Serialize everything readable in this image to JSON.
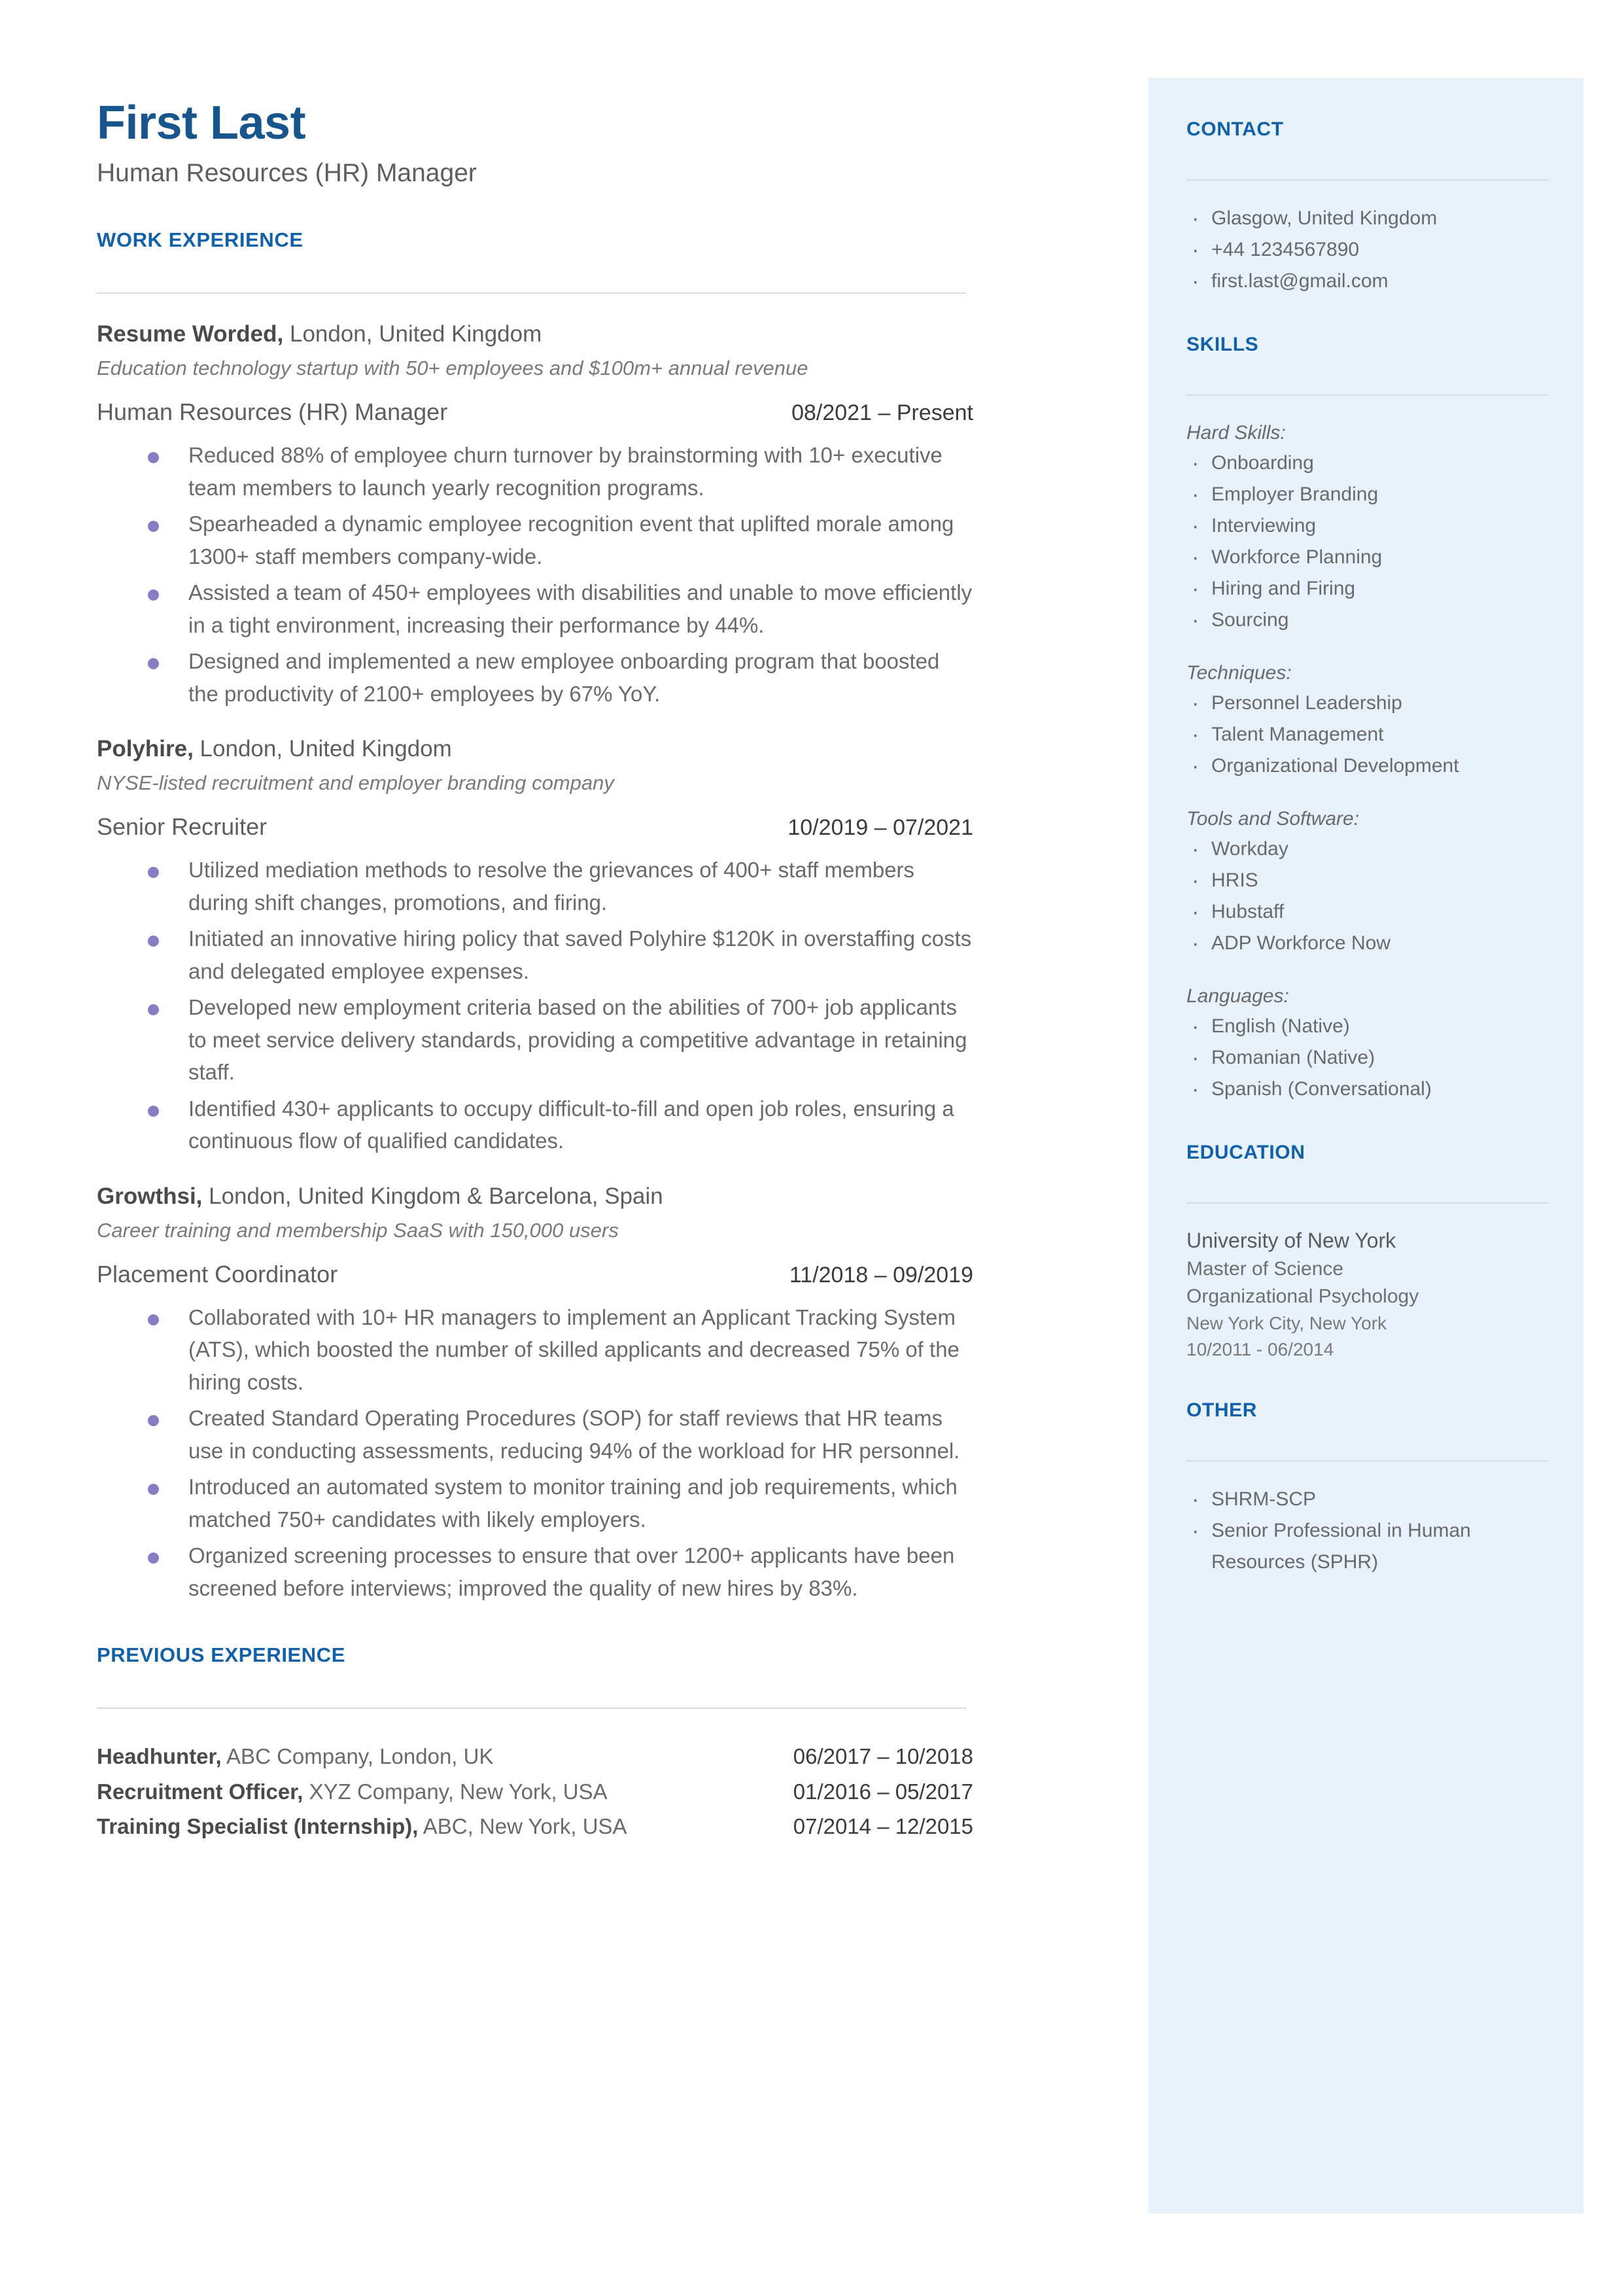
{
  "header": {
    "name": "First Last",
    "title": "Human Resources (HR) Manager"
  },
  "colors": {
    "heading_blue": "#1160aa",
    "name_blue": "#17558c",
    "sidebar_bg": "#e7f2fc",
    "bullet_purple": "#8a7cc4",
    "body_gray": "#6a6a6a",
    "rule_gray": "#dcdcdc"
  },
  "work_experience": {
    "heading": "WORK EXPERIENCE",
    "jobs": [
      {
        "company": "Resume Worded,",
        "location": " London, United Kingdom",
        "description": "Education technology startup with 50+ employees and $100m+ annual revenue",
        "role": "Human Resources (HR) Manager",
        "dates": "08/2021 – Present",
        "bullets": [
          "Reduced 88% of employee churn turnover by brainstorming with 10+ executive team members to launch yearly recognition programs.",
          "Spearheaded a dynamic employee recognition event that uplifted morale among 1300+ staff members company-wide.",
          "Assisted a team of 450+ employees with disabilities and unable to move efficiently in a tight environment, increasing their performance by 44%.",
          "Designed and implemented a new employee onboarding program that boosted the productivity of 2100+ employees by 67% YoY."
        ]
      },
      {
        "company": "Polyhire,",
        "location": " London, United Kingdom",
        "description": "NYSE-listed recruitment and employer branding company",
        "role": "Senior Recruiter",
        "dates": "10/2019 – 07/2021",
        "bullets": [
          "Utilized mediation methods to resolve the grievances of 400+ staff members during shift changes, promotions, and firing.",
          "Initiated an innovative hiring policy that saved Polyhire $120K in overstaffing costs and delegated employee expenses.",
          "Developed new employment criteria based on the abilities of 700+ job applicants to meet service delivery standards, providing a competitive advantage in retaining staff.",
          "Identified 430+ applicants to occupy difficult-to-fill and open job roles, ensuring a continuous flow of qualified candidates."
        ]
      },
      {
        "company": "Growthsi,",
        "location": " London, United Kingdom & Barcelona, Spain",
        "description": "Career training and membership SaaS with 150,000 users",
        "role": "Placement Coordinator",
        "dates": "11/2018 – 09/2019",
        "bullets": [
          "Collaborated with 10+ HR managers to implement an Applicant Tracking System (ATS), which boosted the number of skilled applicants and decreased 75% of the hiring costs.",
          "Created Standard Operating Procedures (SOP) for staff reviews that HR teams use in conducting assessments, reducing 94% of the workload for HR personnel.",
          "Introduced an automated system to monitor training and job requirements, which matched 750+ candidates with likely employers.",
          "Organized screening processes to ensure that over 1200+ applicants have been screened before interviews; improved the quality of new hires by 83%."
        ]
      }
    ]
  },
  "previous_experience": {
    "heading": "PREVIOUS EXPERIENCE",
    "rows": [
      {
        "role": "Headhunter,",
        "detail": " ABC Company, London, UK",
        "dates": "06/2017 – 10/2018"
      },
      {
        "role": "Recruitment Officer,",
        "detail": " XYZ Company, New York, USA",
        "dates": "01/2016 – 05/2017"
      },
      {
        "role": "Training Specialist (Internship),",
        "detail": " ABC, New York, USA",
        "dates": "07/2014 – 12/2015"
      }
    ]
  },
  "sidebar": {
    "contact": {
      "heading": "CONTACT",
      "items": [
        "Glasgow, United Kingdom",
        "+44 1234567890",
        "first.last@gmail.com"
      ]
    },
    "skills": {
      "heading": "SKILLS",
      "groups": [
        {
          "label": "Hard Skills:",
          "items": [
            "Onboarding",
            "Employer Branding",
            "Interviewing",
            "Workforce Planning",
            "Hiring and Firing",
            "Sourcing"
          ]
        },
        {
          "label": "Techniques:",
          "items": [
            "Personnel Leadership",
            "Talent Management",
            "Organizational Development"
          ]
        },
        {
          "label": "Tools and Software:",
          "items": [
            "Workday",
            "HRIS",
            "Hubstaff",
            "ADP Workforce Now"
          ]
        },
        {
          "label": "Languages:",
          "items": [
            "English (Native)",
            "Romanian (Native)",
            "Spanish (Conversational)"
          ]
        }
      ]
    },
    "education": {
      "heading": "EDUCATION",
      "school": "University of New York",
      "degree": "Master of Science",
      "field": "Organizational Psychology",
      "location": "New York City, New York",
      "dates": "10/2011 - 06/2014"
    },
    "other": {
      "heading": "OTHER",
      "items": [
        "SHRM-SCP",
        "Senior Professional in Human Resources (SPHR)"
      ]
    }
  }
}
